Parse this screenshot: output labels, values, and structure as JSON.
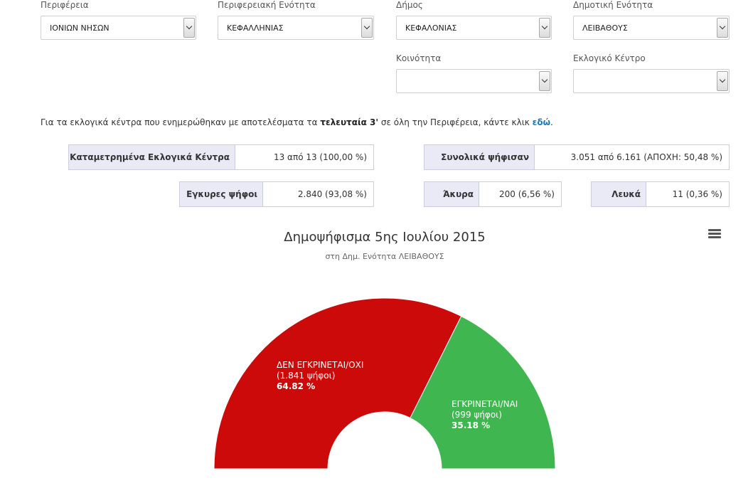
{
  "filters": [
    {
      "label": "Περιφέρεια",
      "value": "ΙΟΝΙΩΝ ΝΗΣΩΝ"
    },
    {
      "label": "Περιφερειακή Ενότητα",
      "value": "ΚΕΦΑΛΛΗΝΙΑΣ"
    },
    {
      "label": "Δήμος",
      "value": "ΚΕΦΑΛΟΝΙΑΣ"
    },
    {
      "label": "Δημοτική Ενότητα",
      "value": "ΛΕΙΒΑΘΟΥΣ"
    },
    {
      "label": "Κοινότητα",
      "value": ""
    },
    {
      "label": "Εκλογικό Κέντρο",
      "value": ""
    }
  ],
  "info": {
    "prefix": "Για τα εκλογικά κέντρα που ενημερώθηκαν με αποτελέσματα τα ",
    "bold": "τελευταία 3'",
    "middle": " σε όλη την Περιφέρεια, κάντε κλικ ",
    "link": "εδώ",
    "suffix": "."
  },
  "stats": {
    "centers": {
      "label": "Καταμετρημένα Εκλογικά Κέντρα",
      "value": "13 από 13   (100,00 %)"
    },
    "voted": {
      "label": "Συνολικά ψήφισαν",
      "value": "3.051 από 6.161   (ΑΠΟΧΗ: 50,48 %)"
    },
    "valid": {
      "label": "Εγκυρες ψήφοι",
      "value": "2.840   (93,08 %)"
    },
    "invalid": {
      "label": "Άκυρα",
      "value": "200   (6,56 %)"
    },
    "blank": {
      "label": "Λευκά",
      "value": "11   (0,36 %)"
    }
  },
  "chart_data": {
    "type": "pie",
    "title": "Δημοψήφισμα 5ης Ιουλίου 2015",
    "subtitle": "στη Δημ. Ενότητα ΛΕΙΒΑΘΟΥΣ",
    "variant": "semi-circle donut",
    "series": [
      {
        "name": "ΔΕΝ ΕΓΚΡΙΝΕΤΑΙ/ΟΧΙ",
        "votes_label": "(1.841 ψήφοι)",
        "percent_label": "64.82 %",
        "value": 64.82,
        "color": "#cc0a0a"
      },
      {
        "name": "ΕΓΚΡΙΝΕΤΑΙ/ΝΑΙ",
        "votes_label": "(999 ψήφοι)",
        "percent_label": "35.18 %",
        "value": 35.18,
        "color": "#3fb64f"
      }
    ]
  },
  "colors": {
    "accent_link": "#1a7bb9",
    "stat_label_bg": "#eaeaf7"
  },
  "icons": {
    "menu": "hamburger-menu-icon",
    "dropdown": "chevron-down-icon"
  }
}
